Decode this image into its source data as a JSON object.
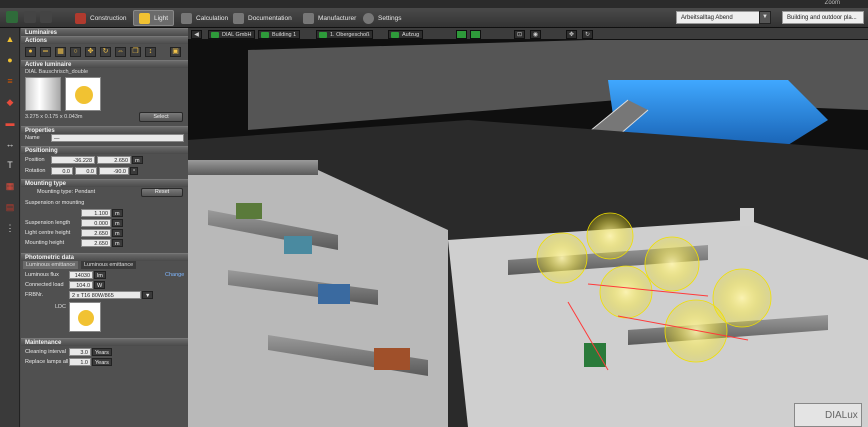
{
  "menu": {
    "app_label": "Zoom"
  },
  "ribbon": {
    "modes": [
      {
        "label": "Construction",
        "icon": "construction-icon",
        "color": "#c0392b"
      },
      {
        "label": "Light",
        "icon": "light-icon",
        "color": "#f1c232"
      },
      {
        "label": "Calculation",
        "icon": "calculation-icon",
        "color": "#666666"
      },
      {
        "label": "Documentation",
        "icon": "documentation-icon",
        "color": "#666666"
      },
      {
        "label": "Manufacturer",
        "icon": "manufacturer-icon",
        "color": "#666666"
      },
      {
        "label": "Settings",
        "icon": "gear-icon",
        "color": "#666666"
      }
    ],
    "scene_select": "Arbeitsalltag Abend",
    "view_select": "Building and outdoor pla..."
  },
  "breadcrumb": [
    "DIAL GmbH",
    "Building 1",
    "1. Obergeschoß",
    "Aufzug"
  ],
  "panel": {
    "luminaires_header": "Luminaires",
    "actions_header": "Actions",
    "active_luminaire_header": "Active luminaire",
    "luminaire_name": "DIAL Bauschrisch_double",
    "dimensions": "3.275 x 0.175 x 0.043m",
    "select_button": "Select",
    "properties_header": "Properties",
    "name_label": "Name",
    "name_value": "—",
    "positioning_header": "Positioning",
    "position_label": "Position",
    "position_x": "-36.228",
    "position_y": "2.650",
    "position_unit": "m",
    "rotation_label": "Rotation",
    "rotation_x": "0.0",
    "rotation_y": "0.0",
    "rotation_z": "-90.0",
    "rotation_unit": "°",
    "mounting_header": "Mounting type",
    "mounting_type": "Mounting type: Pendant",
    "reset_button": "Reset",
    "suspension_heading": "Suspension or mounting",
    "suspension_value": "1.100",
    "suspension_length_label": "Suspension length",
    "suspension_length_value": "0.000",
    "light_centre_label": "Light centre height",
    "light_centre_value": "2.650",
    "mounting_height_label": "Mounting height",
    "mounting_height_value": "2.650",
    "photometric_header": "Photometric data",
    "tab_luminous_emittance_1": "Luminous emittance",
    "tab_luminous_emittance_2": "Luminous emittance",
    "luminous_flux_label": "Luminous flux",
    "luminous_flux_value": "14030",
    "luminous_flux_unit": "lm",
    "connected_load_label": "Connected load",
    "connected_load_value": "104.0",
    "connected_load_unit": "W",
    "change_link": "Change",
    "fitting_label": "FRBNr.",
    "fitting_value": "2 x T16 80W/865",
    "ldc_label": "LDC",
    "maintenance_header": "Maintenance",
    "cleaning_label": "Cleaning interval",
    "cleaning_value": "3.0",
    "cleaning_unit": "Years",
    "replace_label": "Replace lamps all",
    "replace_value": "1.0",
    "replace_unit": "Years"
  },
  "watermark": "DIALux"
}
